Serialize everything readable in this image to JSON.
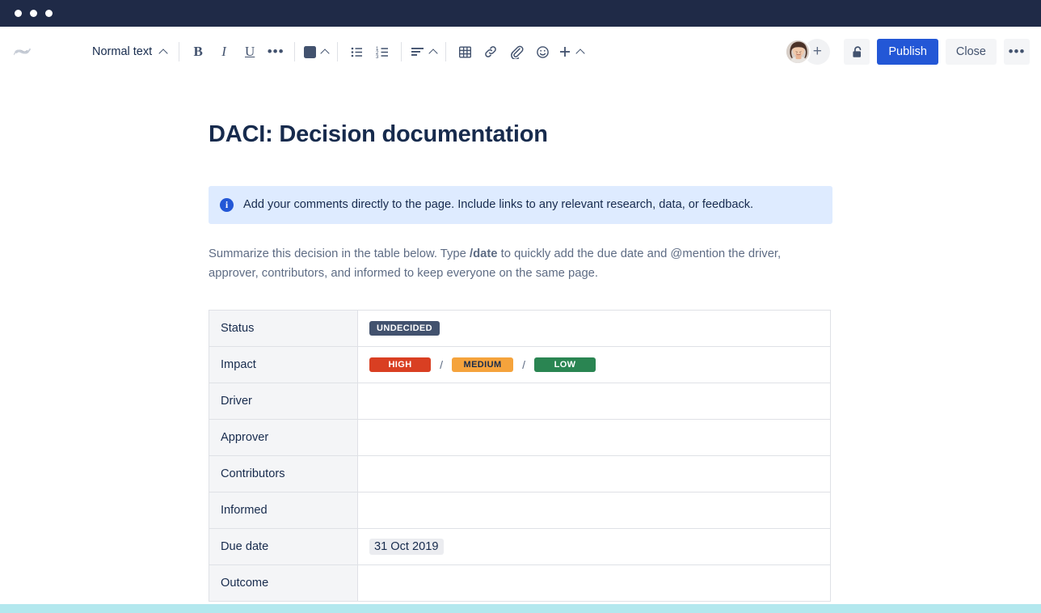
{
  "window": {
    "chrome_dots": [
      "dot-1",
      "dot-2",
      "dot-3"
    ],
    "chrome_color": "#1f2a47"
  },
  "toolbar": {
    "app_logo_name": "confluence-logo",
    "text_style_label": "Normal text",
    "format_buttons": [
      {
        "name": "bold",
        "glyph": "B"
      },
      {
        "name": "italic",
        "glyph": "I"
      },
      {
        "name": "underline",
        "glyph": "U"
      },
      {
        "name": "more-formatting",
        "glyph": "•••"
      }
    ],
    "text_color_label": "text-color",
    "text_color_value": "#42526e",
    "list_buttons": [
      {
        "name": "bulleted-list",
        "glyph": "≡"
      },
      {
        "name": "numbered-list",
        "glyph": "≡"
      }
    ],
    "align_label": "text-align",
    "insert_buttons": [
      {
        "name": "table",
        "glyph": "⊞"
      },
      {
        "name": "link",
        "glyph": "🔗"
      },
      {
        "name": "attachment",
        "glyph": "📎"
      },
      {
        "name": "emoji",
        "glyph": "☺"
      },
      {
        "name": "insert-more",
        "glyph": "+"
      }
    ],
    "avatar_alt": "user-avatar",
    "add_collaborator_label": "+",
    "restrictions_label": "unlock-icon",
    "publish_label": "Publish",
    "close_label": "Close",
    "more_label": "•••",
    "publish_color": "#2357d6"
  },
  "page": {
    "title": "DACI: Decision documentation",
    "info_panel": {
      "icon": "info-icon",
      "text": "Add your comments directly to the page. Include links to any relevant research, data, or feedback.",
      "background": "#deebff"
    },
    "paragraph": {
      "part1": "Summarize this decision in the table below. Type ",
      "bold": "/date",
      "part2": " to quickly add the due date and @mention the driver, approver, contributors, and informed to keep everyone on the same page."
    },
    "table": {
      "rows": [
        {
          "label": "Status",
          "type": "badges",
          "badges": [
            {
              "text": "UNDECIDED",
              "style": "undecided",
              "color": "#42526e"
            }
          ]
        },
        {
          "label": "Impact",
          "type": "badges-sep",
          "badges": [
            {
              "text": "HIGH",
              "style": "high",
              "color": "#d93f22"
            },
            {
              "text": "MEDIUM",
              "style": "medium",
              "color": "#f5a33c"
            },
            {
              "text": "LOW",
              "style": "low",
              "color": "#2a8552"
            }
          ],
          "separator": "/"
        },
        {
          "label": "Driver",
          "type": "empty",
          "value": ""
        },
        {
          "label": "Approver",
          "type": "empty",
          "value": ""
        },
        {
          "label": "Contributors",
          "type": "empty",
          "value": ""
        },
        {
          "label": "Informed",
          "type": "empty",
          "value": ""
        },
        {
          "label": "Due date",
          "type": "chip",
          "value": "31 Oct 2019"
        },
        {
          "label": "Outcome",
          "type": "empty",
          "value": ""
        }
      ]
    }
  },
  "bottom_band_color": "#b3e8ee"
}
